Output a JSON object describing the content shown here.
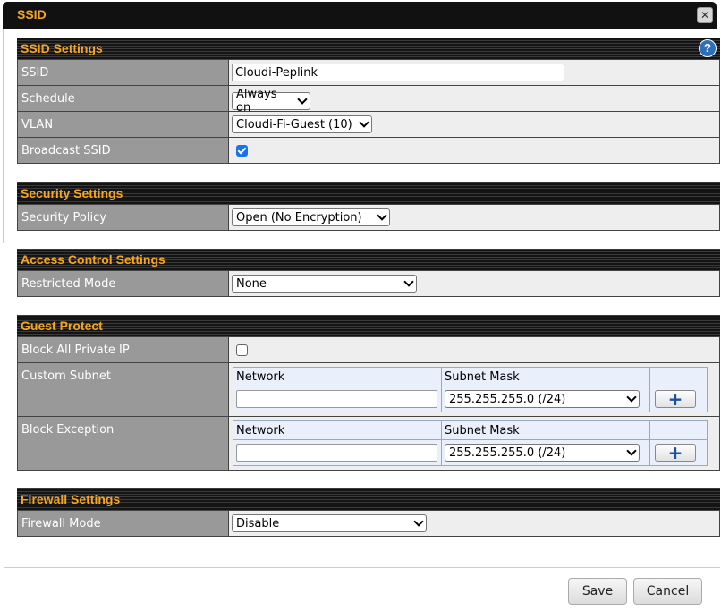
{
  "dialog": {
    "title": "SSID",
    "close_glyph": "✕"
  },
  "ssid_settings": {
    "header": "SSID Settings",
    "help_glyph": "?",
    "ssid_label": "SSID",
    "ssid_value": "Cloudi-Peplink",
    "schedule_label": "Schedule",
    "schedule_value": "Always on",
    "vlan_label": "VLAN",
    "vlan_value": "Cloudi-Fi-Guest (10)",
    "broadcast_label": "Broadcast SSID",
    "broadcast_checked": true
  },
  "security_settings": {
    "header": "Security Settings",
    "policy_label": "Security Policy",
    "policy_value": "Open (No Encryption)"
  },
  "access_control": {
    "header": "Access Control Settings",
    "restricted_label": "Restricted Mode",
    "restricted_value": "None"
  },
  "guest_protect": {
    "header": "Guest Protect",
    "block_private_label": "Block All Private IP",
    "block_private_checked": false,
    "custom_subnet_label": "Custom Subnet",
    "block_exception_label": "Block Exception",
    "network_header": "Network",
    "mask_header": "Subnet Mask",
    "custom_subnet": {
      "network_value": "",
      "mask_value": "255.255.255.0 (/24)"
    },
    "block_exception": {
      "network_value": "",
      "mask_value": "255.255.255.0 (/24)"
    },
    "add_glyph": "+"
  },
  "firewall_settings": {
    "header": "Firewall Settings",
    "mode_label": "Firewall Mode",
    "mode_value": "Disable"
  },
  "footer": {
    "save_label": "Save",
    "cancel_label": "Cancel"
  },
  "colors": {
    "accent": "#f5a623",
    "header_bg": "#141414",
    "label_bg": "#999999",
    "value_bg": "#eeeeee",
    "checkbox": "#1a73e8"
  }
}
